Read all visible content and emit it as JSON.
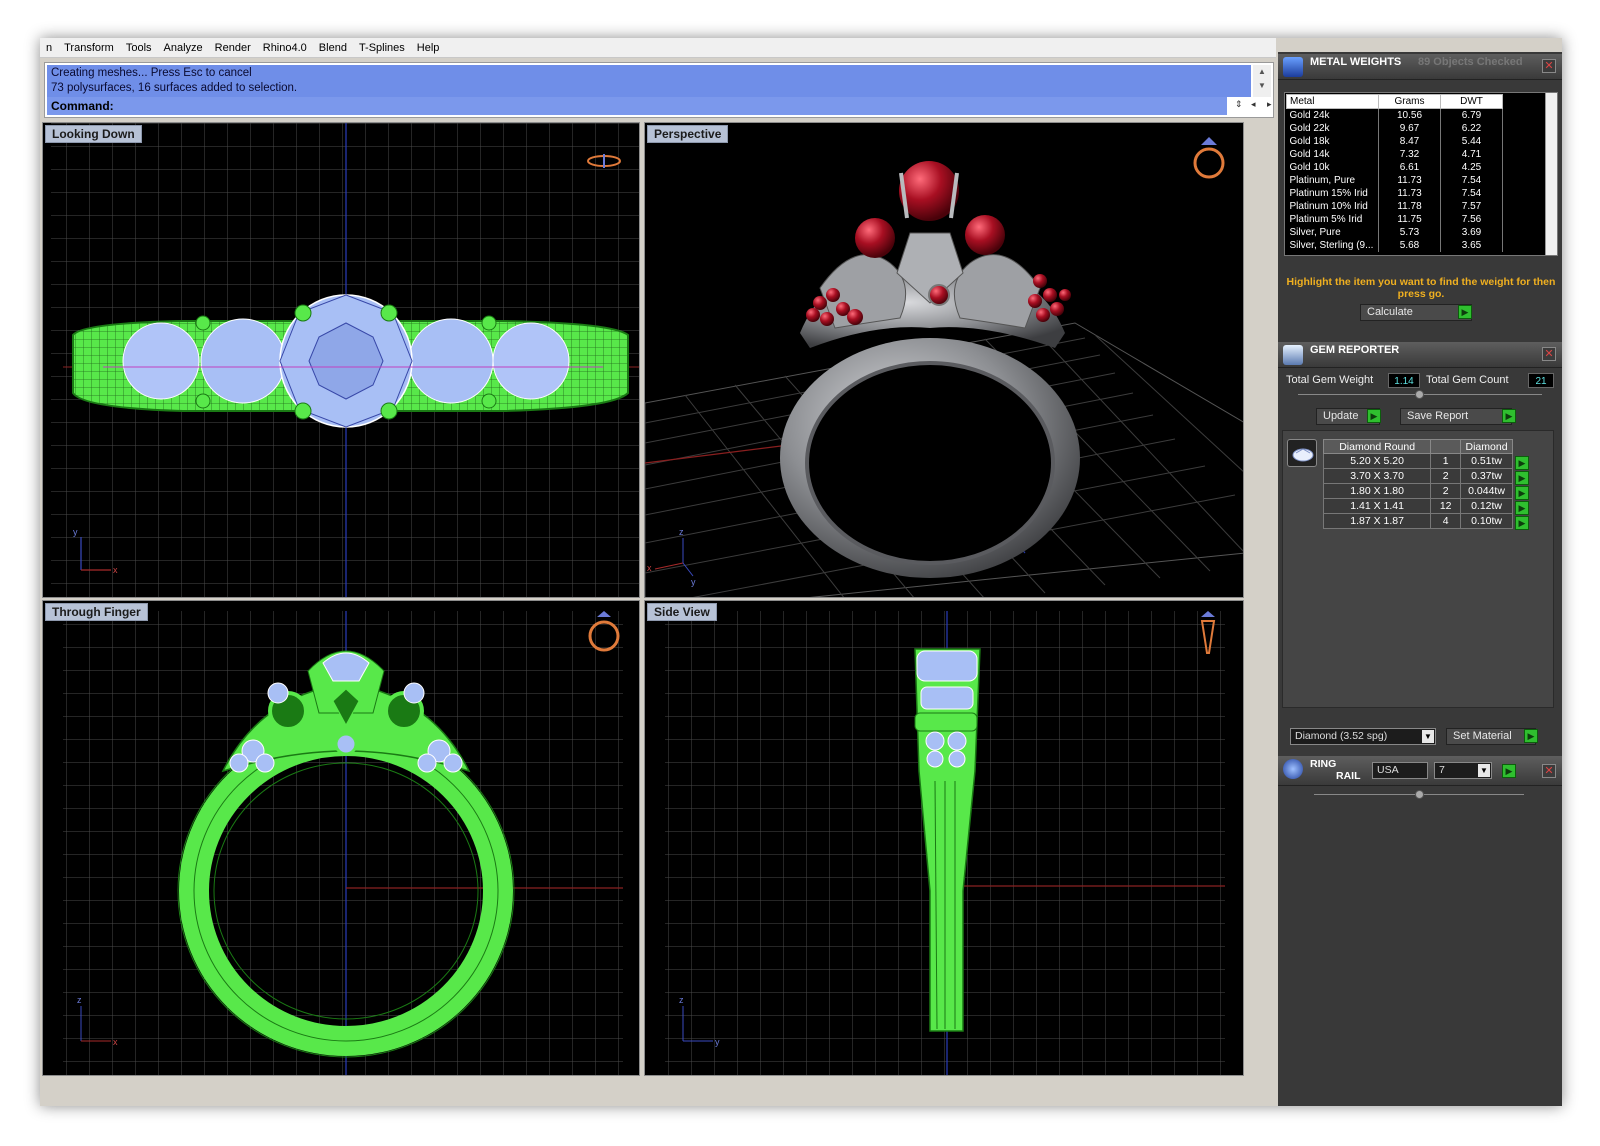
{
  "menu": [
    "Transform",
    "Tools",
    "Analyze",
    "Render",
    "Rhino4.0",
    "Blend",
    "T-Splines",
    "Help"
  ],
  "command": {
    "history": [
      "Creating meshes... Press Esc to cancel",
      "73 polysurfaces, 16 surfaces added to selection."
    ],
    "prompt": "Command:"
  },
  "viewports": {
    "top_left": "Looking Down",
    "top_right": "Perspective",
    "bottom_left": "Through Finger",
    "bottom_right": "Side View"
  },
  "axes": {
    "x": "x",
    "y": "y",
    "z": "z"
  },
  "metal_weights": {
    "title": "METAL WEIGHTS",
    "status": "89 Objects Checked",
    "columns": [
      "Metal",
      "Grams",
      "DWT"
    ],
    "rows": [
      [
        "Gold 24k",
        "10.56",
        "6.79"
      ],
      [
        "Gold 22k",
        "9.67",
        "6.22"
      ],
      [
        "Gold 18k",
        "8.47",
        "5.44"
      ],
      [
        "Gold 14k",
        "7.32",
        "4.71"
      ],
      [
        "Gold 10k",
        "6.61",
        "4.25"
      ],
      [
        "Platinum, Pure",
        "11.73",
        "7.54"
      ],
      [
        "Platinum 15% Irid",
        "11.73",
        "7.54"
      ],
      [
        "Platinum 10% Irid",
        "11.78",
        "7.57"
      ],
      [
        "Platinum 5% Irid",
        "11.75",
        "7.56"
      ],
      [
        "Silver, Pure",
        "5.73",
        "3.69"
      ],
      [
        "Silver, Sterling (9...",
        "5.68",
        "3.65"
      ]
    ],
    "hint": "Highlight the item you want to find the weight for then press go.",
    "calculate": "Calculate"
  },
  "gem_reporter": {
    "title": "GEM REPORTER",
    "total_weight_label": "Total Gem Weight",
    "total_weight": "1.14",
    "total_count_label": "Total Gem Count",
    "total_count": "21",
    "update": "Update",
    "save_report": "Save Report",
    "columns": [
      "Diamond Round",
      "",
      "Diamond"
    ],
    "rows": [
      [
        "5.20 X 5.20",
        "1",
        "0.51tw"
      ],
      [
        "3.70 X 3.70",
        "2",
        "0.37tw"
      ],
      [
        "1.80 X 1.80",
        "2",
        "0.044tw"
      ],
      [
        "1.41 X 1.41",
        "12",
        "0.12tw"
      ],
      [
        "1.87 X 1.87",
        "4",
        "0.10tw"
      ]
    ],
    "material": "Diamond   (3.52 spg)",
    "set_material": "Set Material"
  },
  "ring_rail": {
    "title_1": "RING",
    "title_2": "RAIL",
    "country": "USA",
    "size": "7"
  },
  "colors": {
    "wire_green": "#58e84a",
    "wire_blue": "#a8bff5",
    "metal": "#8c8e92",
    "ruby": "#a80f22",
    "accent_orange": "#f0b020",
    "command_blue": "#6f8ee8"
  }
}
